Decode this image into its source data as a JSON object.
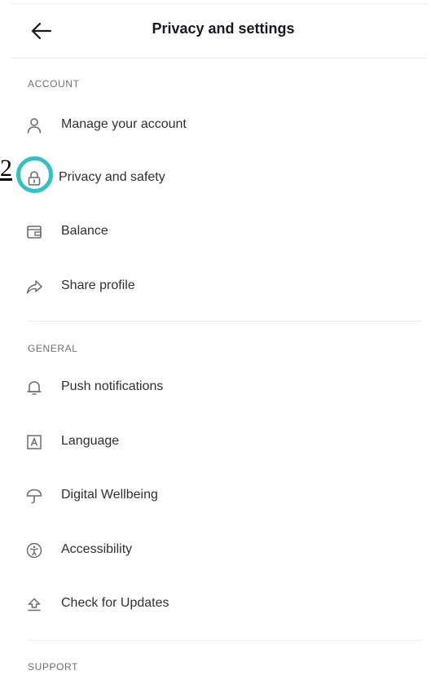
{
  "header": {
    "title": "Privacy and settings",
    "back_icon": "arrow-left-icon"
  },
  "annotation": {
    "step_number": "2",
    "ring_color": "#34c0c9"
  },
  "sections": [
    {
      "label": "ACCOUNT",
      "items": [
        {
          "label": "Manage your account",
          "icon": "person-icon"
        },
        {
          "label": "Privacy and safety",
          "icon": "lock-icon"
        },
        {
          "label": "Balance",
          "icon": "wallet-icon"
        },
        {
          "label": "Share profile",
          "icon": "share-icon"
        }
      ]
    },
    {
      "label": "GENERAL",
      "items": [
        {
          "label": "Push notifications",
          "icon": "bell-icon"
        },
        {
          "label": "Language",
          "icon": "language-icon"
        },
        {
          "label": "Digital Wellbeing",
          "icon": "umbrella-icon"
        },
        {
          "label": "Accessibility",
          "icon": "accessibility-icon"
        },
        {
          "label": "Check for Updates",
          "icon": "update-icon"
        }
      ]
    },
    {
      "label": "SUPPORT",
      "items": []
    }
  ],
  "colors": {
    "text": "#161823",
    "item_text": "#2f2f35",
    "section_label": "#6f6f75",
    "icon": "#6b6b70",
    "divider": "#ececec"
  }
}
